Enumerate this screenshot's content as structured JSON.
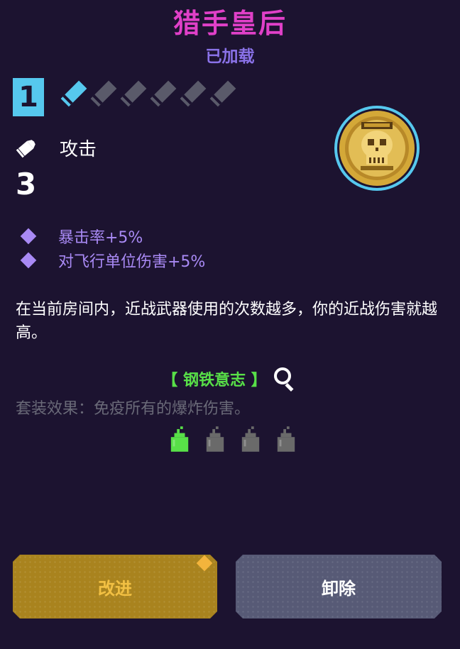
{
  "colors": {
    "background": "#1c1330",
    "title": "#e040c8",
    "status": "#8a72e8",
    "level_box": "#56c8ee",
    "pip_active": "#56c8ee",
    "pip_inactive": "#5a5a6a",
    "bonus": "#a98af5",
    "set_title": "#58e048",
    "set_effect": "#6a6a78",
    "piece_active": "#58e048",
    "piece_inactive": "#6a6a6a",
    "upgrade_bg": "#a9831e",
    "upgrade_text": "#f2c043",
    "unequip_bg": "#575a76",
    "unequip_text": "#ffffff",
    "notice_dot": "#f3b43c"
  },
  "weapon": {
    "name": "猎手皇后",
    "status": "已加载",
    "level": "1",
    "upgrade_pips_total": 6,
    "upgrade_pips_filled": 1,
    "attack_label": "攻击",
    "damage": "3",
    "icon": "golden-skull-medallion-icon"
  },
  "bonuses": [
    {
      "text": "暴击率+5%"
    },
    {
      "text": "对飞行单位伤害+5%"
    }
  ],
  "description": "在当前房间内，近战武器使用的次数越多，你的近战伤害就越高。",
  "set": {
    "title": "【 钢铁意志 】",
    "effect": "套装效果：免疫所有的爆炸伤害。",
    "pieces_total": 4,
    "pieces_collected": 1
  },
  "buttons": {
    "upgrade": "改进",
    "unequip": "卸除"
  }
}
